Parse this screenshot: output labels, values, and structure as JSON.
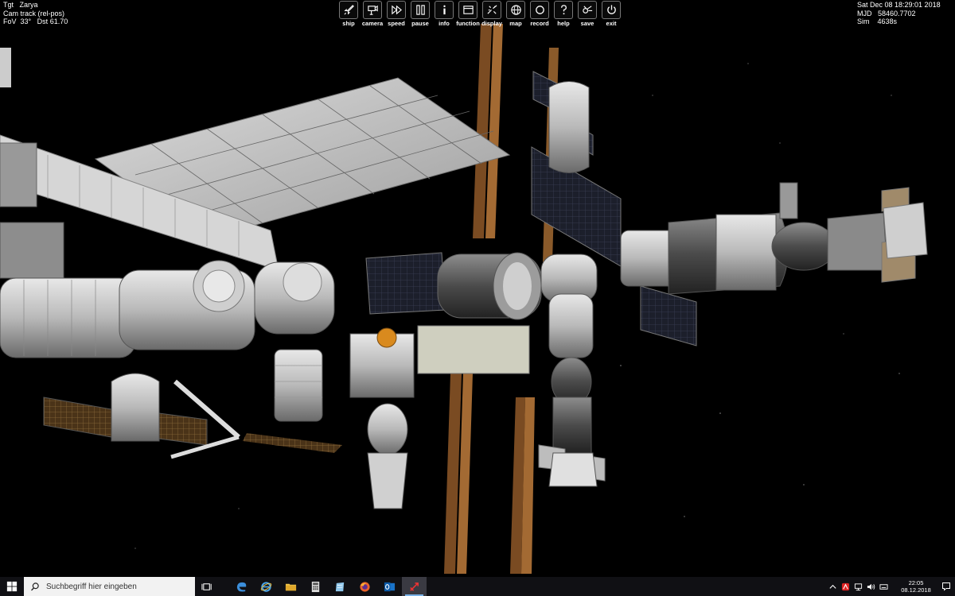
{
  "hud": {
    "target_label": "Tgt",
    "target_value": "Zarya",
    "camera_mode": "Cam track (rel-pos)",
    "fov_label": "FoV",
    "fov_value": "33°",
    "dst_label": "Dst",
    "dst_value": "61.70",
    "date": "Sat Dec 08 18:29:01 2018",
    "mjd_label": "MJD",
    "mjd_value": "58460.7702",
    "sim_label": "Sim",
    "sim_value": "4638s"
  },
  "toolbar": [
    {
      "label": "ship",
      "icon": "rocket-icon"
    },
    {
      "label": "camera",
      "icon": "camera-icon"
    },
    {
      "label": "speed",
      "icon": "fast-forward-icon"
    },
    {
      "label": "pause",
      "icon": "pause-icon"
    },
    {
      "label": "info",
      "icon": "info-icon"
    },
    {
      "label": "function",
      "icon": "window-icon"
    },
    {
      "label": "display",
      "icon": "display-icon"
    },
    {
      "label": "map",
      "icon": "globe-icon"
    },
    {
      "label": "record",
      "icon": "record-icon"
    },
    {
      "label": "help",
      "icon": "help-icon"
    },
    {
      "label": "save",
      "icon": "save-icon"
    },
    {
      "label": "exit",
      "icon": "power-icon"
    }
  ],
  "taskbar": {
    "search_placeholder": "Suchbegriff hier eingeben",
    "apps": [
      "task-view-icon",
      "edge-icon",
      "internet-explorer-icon",
      "file-explorer-icon",
      "calculator-icon",
      "notepad-icon",
      "firefox-icon",
      "outlook-icon",
      "orbiter-icon"
    ],
    "clock_time": "22:05",
    "clock_date": "08.12.2018"
  },
  "colors": {
    "space": "#000000",
    "taskbar": "#101014",
    "accent": "#7ab3e8",
    "solar_panel": "#c9c9c9",
    "radiator": "#8a5a2a"
  }
}
